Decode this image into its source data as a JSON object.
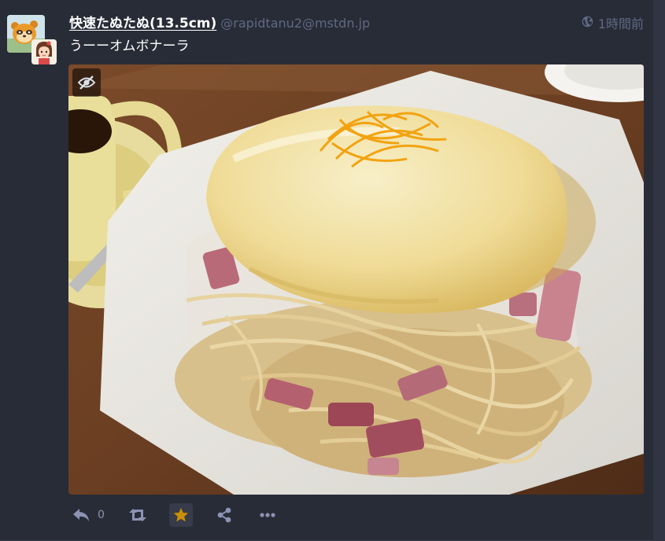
{
  "status": {
    "account": {
      "display_name": "快速たぬたぬ(13.5cm)",
      "acct": "@rapidtanu2@mstdn.jp"
    },
    "visibility_icon": "globe-icon",
    "relative_time": "1時間前",
    "content": "うーーオムボナーラ",
    "media": {
      "type": "photo",
      "sensitive_toggle_icon": "eye-slash-icon"
    },
    "actions": {
      "reply_icon": "reply-icon",
      "reply_count": "0",
      "boost_icon": "retweet-icon",
      "favourite_icon": "star-icon",
      "favourited": true,
      "share_icon": "share-icon",
      "more_icon": "ellipsis-icon"
    }
  },
  "colors": {
    "background": "#282c37",
    "text": "#ffffff",
    "muted": "#606984",
    "action": "#8c93b3",
    "favourite": "#ca8f04"
  }
}
